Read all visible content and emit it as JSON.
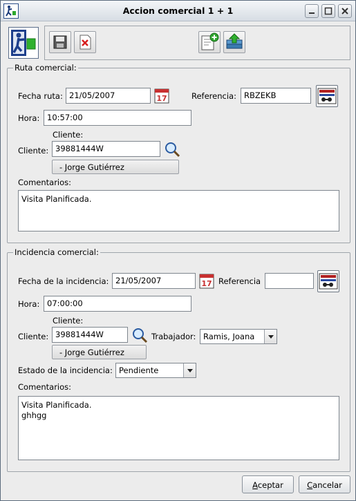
{
  "window": {
    "title": "Accion comercial 1 + 1",
    "controls": [
      "minimize-icon",
      "maximize-icon",
      "close-icon"
    ]
  },
  "toolbar": {
    "items": [
      "person-exit-icon",
      "save-icon",
      "delete-icon",
      "add-document-icon",
      "upload-stack-icon"
    ]
  },
  "ruta": {
    "legend": "Ruta comercial:",
    "fecha_label": "Fecha ruta:",
    "fecha_value": "21/05/2007",
    "calendar_icon_text": "17",
    "referencia_label": "Referencia:",
    "referencia_value": "RBZEKB",
    "hora_label": "Hora:",
    "hora_value": "10:57:00",
    "cliente_caption": "Cliente:",
    "cliente_label": "Cliente:",
    "cliente_value": "39881444W",
    "cliente_name": "- Jorge Gutiérrez",
    "comentarios_label": "Comentarios:",
    "comentarios_value": "Visita Planificada."
  },
  "incidencia": {
    "legend": "Incidencia comercial:",
    "fecha_label": "Fecha de la incidencia:",
    "fecha_value": "21/05/2007",
    "calendar_icon_text": "17",
    "referencia_label": "Referencia",
    "referencia_value": "",
    "hora_label": "Hora:",
    "hora_value": "07:00:00",
    "cliente_caption": "Cliente:",
    "cliente_label": "Cliente:",
    "cliente_value": "39881444W",
    "cliente_name": "- Jorge Gutiérrez",
    "trabajador_label": "Trabajador:",
    "trabajador_value": "Ramis, Joana",
    "estado_label": "Estado de la incidencia:",
    "estado_value": "Pendiente",
    "comentarios_label": "Comentarios:",
    "comentarios_value": "Visita Planificada.\nghhgg"
  },
  "footer": {
    "aceptar_rest": "ceptar",
    "aceptar_mnemonic": "A",
    "cancelar_rest": "ancelar",
    "cancelar_mnemonic": "C"
  }
}
